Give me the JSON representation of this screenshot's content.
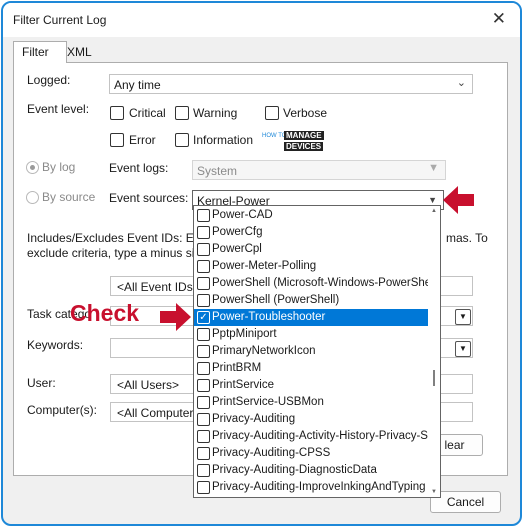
{
  "window": {
    "title": "Filter Current Log",
    "close_glyph": "✕"
  },
  "tabs": [
    {
      "label": "Filter"
    },
    {
      "label": "XML"
    }
  ],
  "form": {
    "logged_label": "Logged:",
    "logged_value": "Any time",
    "event_level_label": "Event level:",
    "levels": [
      "Critical",
      "Warning",
      "Verbose",
      "Error",
      "Information"
    ],
    "by_log_label": "By log",
    "by_source_label": "By source",
    "event_logs_label": "Event logs:",
    "event_logs_value": "System",
    "event_sources_label": "Event sources:",
    "event_sources_value": "Kernel-Power",
    "includes_line1_left": "Includes/Excludes Event IDs: Ente",
    "includes_line1_right": "mas. To",
    "includes_line2": "exclude criteria, type a minus sign",
    "event_ids_value": "<All Event IDs>",
    "task_category_label": "Task catego",
    "keywords_label": "Keywords:",
    "user_label": "User:",
    "user_value": "<All Users>",
    "computers_label": "Computer(s):",
    "computers_value": "<All Computers",
    "clear_label": "lear",
    "cancel_label": "Cancel"
  },
  "dropdown_items": [
    "Power-CAD",
    "PowerCfg",
    "PowerCpl",
    "Power-Meter-Polling",
    "PowerShell (Microsoft-Windows-PowerShell)",
    "PowerShell (PowerShell)",
    "Power-Troubleshooter",
    "PptpMiniport",
    "PrimaryNetworkIcon",
    "PrintBRM",
    "PrintService",
    "PrintService-USBMon",
    "Privacy-Auditing",
    "Privacy-Auditing-Activity-History-Privacy-S",
    "Privacy-Auditing-CPSS",
    "Privacy-Auditing-DiagnosticData",
    "Privacy-Auditing-ImproveInkingAndTyping"
  ],
  "selected_item": "Power-Troubleshooter",
  "annotation": {
    "check_label": "Check"
  },
  "logo": {
    "line1": "HOW TO",
    "line2": "MANAGE",
    "line3": "DEVICES"
  },
  "colors": {
    "accent": "#0078d7",
    "annotation_red": "#c8102e",
    "frame_blue": "#1e88d8"
  }
}
